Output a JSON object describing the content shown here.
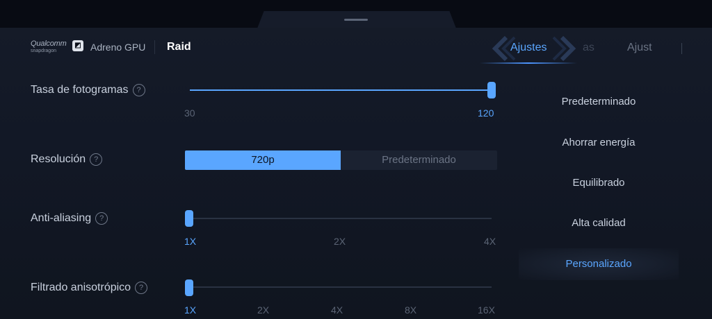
{
  "header": {
    "brand_line1": "Qualcomm",
    "brand_line2": "snapdragon",
    "gpu_label": "Adreno GPU",
    "game_name": "Raid"
  },
  "tabs": [
    {
      "label": "Ajustes",
      "active": true
    },
    {
      "label": "as",
      "active": false
    },
    {
      "label": "Ajust",
      "active": false
    }
  ],
  "settings": {
    "frame_rate": {
      "label": "Tasa de fotogramas",
      "min": "30",
      "max": "120",
      "value": 120
    },
    "resolution": {
      "label": "Resolución",
      "options": [
        "720p",
        "Predeterminado"
      ],
      "selected": "720p"
    },
    "anti_aliasing": {
      "label": "Anti-aliasing",
      "ticks": [
        "1X",
        "2X",
        "4X"
      ],
      "selected": "1X"
    },
    "anisotropic": {
      "label": "Filtrado anisotrópico",
      "ticks": [
        "1X",
        "2X",
        "4X",
        "8X",
        "16X"
      ],
      "selected": "1X"
    }
  },
  "presets": [
    {
      "label": "Predeterminado",
      "active": false
    },
    {
      "label": "Ahorrar energía",
      "active": false
    },
    {
      "label": "Equilibrado",
      "active": false
    },
    {
      "label": "Alta calidad",
      "active": false
    },
    {
      "label": "Personalizado",
      "active": true
    }
  ],
  "colors": {
    "accent": "#5aa6ff",
    "background": "#121826"
  }
}
